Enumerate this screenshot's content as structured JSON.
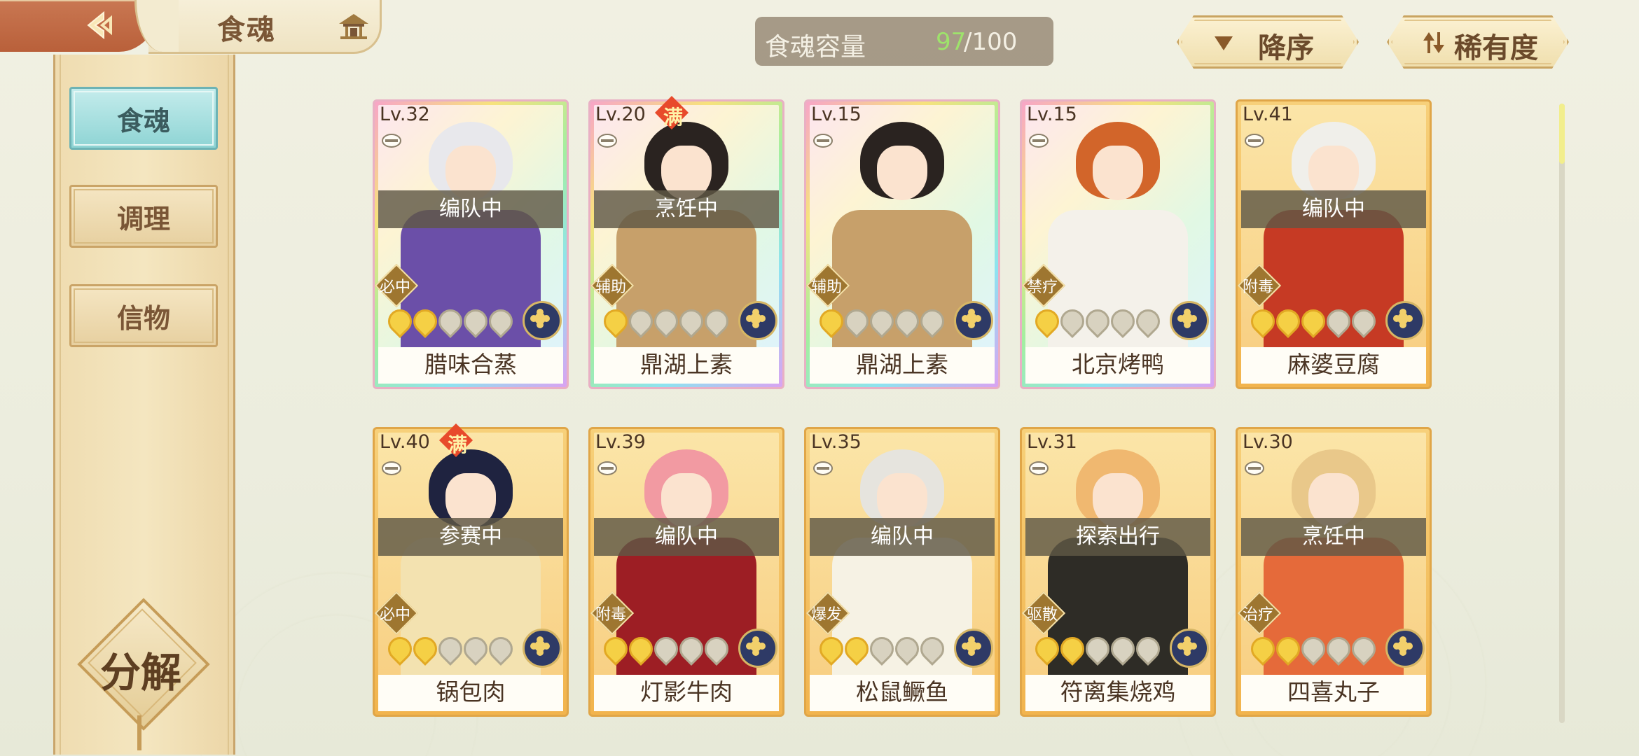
{
  "header": {
    "title": "食魂",
    "capacity_label": "食魂容量",
    "capacity_current": "97",
    "capacity_max": "/100",
    "sort_order_label": "降序",
    "sort_by_label": "稀有度"
  },
  "sidebar": {
    "tabs": [
      {
        "label": "食魂",
        "active": true
      },
      {
        "label": "调理",
        "active": false
      },
      {
        "label": "信物",
        "active": false
      }
    ],
    "decompose_label": "分解"
  },
  "icons": {
    "back": "back-arrow-icon",
    "pavilion": "pavilion-icon",
    "sort_order": "triangle-down-icon",
    "sort_by": "sort-arrows-icon"
  },
  "colors": {
    "accent_teal": "#8ed4d4",
    "capacity_green": "#9ee36b",
    "gold_frame": "#f2b44d",
    "status_bar": "#5f5846"
  },
  "cards": [
    {
      "level": "Lv.32",
      "name": "腊味合蒸",
      "status": "编队中",
      "role": "必中",
      "stars": 2,
      "frame": "rainbow",
      "full": false,
      "hair": "#e8e8ec",
      "outfit": "#6b4fa8",
      "max_badge": ""
    },
    {
      "level": "Lv.20",
      "name": "鼎湖上素",
      "status": "烹饪中",
      "role": "辅助",
      "stars": 1,
      "frame": "rainbow",
      "full": true,
      "hair": "#2a2320",
      "outfit": "#c7a06a",
      "max_badge": "满"
    },
    {
      "level": "Lv.15",
      "name": "鼎湖上素",
      "status": "",
      "role": "辅助",
      "stars": 1,
      "frame": "rainbow",
      "full": false,
      "hair": "#2a2320",
      "outfit": "#c7a06a",
      "max_badge": ""
    },
    {
      "level": "Lv.15",
      "name": "北京烤鸭",
      "status": "",
      "role": "禁疗",
      "stars": 1,
      "frame": "rainbow",
      "full": false,
      "hair": "#d2652a",
      "outfit": "#f4f1ea",
      "max_badge": ""
    },
    {
      "level": "Lv.41",
      "name": "麻婆豆腐",
      "status": "编队中",
      "role": "附毒",
      "stars": 3,
      "frame": "gold",
      "full": false,
      "hair": "#f0efea",
      "outfit": "#c63a24",
      "max_badge": ""
    },
    {
      "level": "Lv.40",
      "name": "锅包肉",
      "status": "参赛中",
      "role": "必中",
      "stars": 2,
      "frame": "gold",
      "full": true,
      "hair": "#1f2340",
      "outfit": "#f3e2b0",
      "max_badge": "满"
    },
    {
      "level": "Lv.39",
      "name": "灯影牛肉",
      "status": "编队中",
      "role": "附毒",
      "stars": 2,
      "frame": "gold",
      "full": false,
      "hair": "#f29aa2",
      "outfit": "#9d1e24",
      "max_badge": ""
    },
    {
      "level": "Lv.35",
      "name": "松鼠鳜鱼",
      "status": "编队中",
      "role": "爆发",
      "stars": 2,
      "frame": "gold",
      "full": false,
      "hair": "#e6e4de",
      "outfit": "#f6f2e4",
      "max_badge": ""
    },
    {
      "level": "Lv.31",
      "name": "符离集烧鸡",
      "status": "探索出行",
      "role": "驱散",
      "stars": 2,
      "frame": "gold",
      "full": false,
      "hair": "#f0b870",
      "outfit": "#2e2c26",
      "max_badge": ""
    },
    {
      "level": "Lv.30",
      "name": "四喜丸子",
      "status": "烹饪中",
      "role": "治疗",
      "stars": 2,
      "frame": "gold",
      "full": false,
      "hair": "#e9c88a",
      "outfit": "#e56a3a",
      "max_badge": ""
    }
  ]
}
